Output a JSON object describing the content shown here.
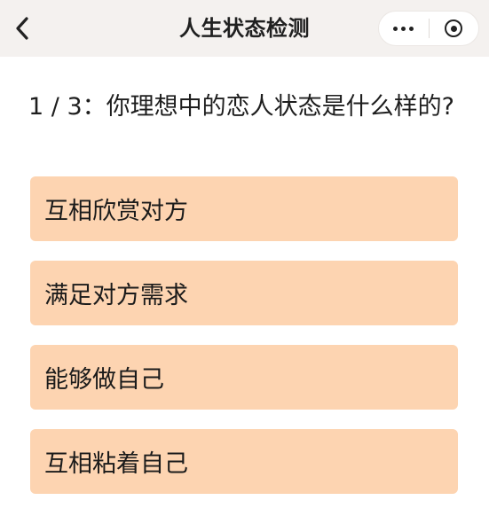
{
  "nav": {
    "title": "人生状态检测",
    "back_icon": "chevron-left-icon",
    "more_icon": "more-dots-icon",
    "close_icon": "target-circle-icon"
  },
  "question": {
    "text": "1 / 3：你理想中的恋人状态是什么样的?"
  },
  "options": [
    {
      "label": "互相欣赏对方"
    },
    {
      "label": "满足对方需求"
    },
    {
      "label": "能够做自己"
    },
    {
      "label": "互相粘着自己"
    }
  ],
  "colors": {
    "navbar_background": "#f4f1ef",
    "option_background": "#fdd4b1",
    "text": "#1e1e1e"
  }
}
